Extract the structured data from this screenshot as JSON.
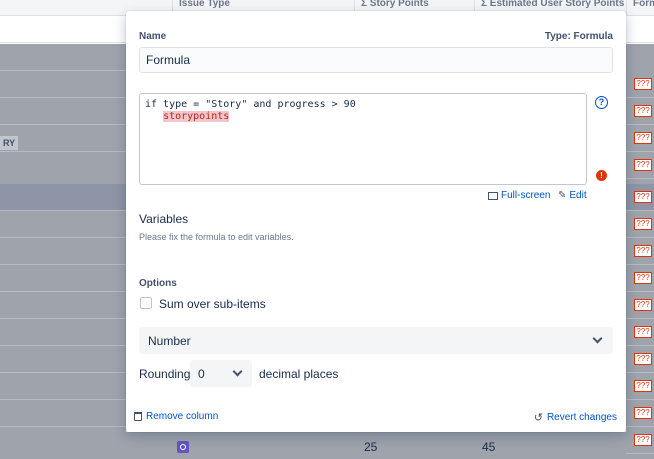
{
  "table_header": {
    "columns": [
      "Issue Type",
      "Σ Story Points",
      "Σ Estimated User Story Points",
      "Form"
    ]
  },
  "left_tag": "RY",
  "right_badge": "???",
  "bottom_row": {
    "story_points": "25",
    "estimated_points": "45"
  },
  "panel": {
    "name_label": "Name",
    "type_label": "Type: Formula",
    "name_value": "Formula",
    "formula_line1": "if type = \"Story\" and progress > 90",
    "formula_line2_indent": "   ",
    "formula_line2_highlight": "storypoints",
    "help_icon_text": "?",
    "warn_icon_text": "!",
    "fullscreen_label": "Full-screen",
    "edit_label": "Edit",
    "variables_title": "Variables",
    "variables_message": "Please fix the formula to edit variables.",
    "options_title": "Options",
    "sum_over_label": "Sum over sub-items",
    "format_value": "Number",
    "rounding_label": "Rounding",
    "rounding_value": "0",
    "decimal_label": "decimal places",
    "remove_column_label": "Remove column",
    "revert_label": "Revert changes"
  },
  "colors": {
    "accent": "#0052cc",
    "error": "#de350b",
    "overlay": "#9ea3ac"
  }
}
